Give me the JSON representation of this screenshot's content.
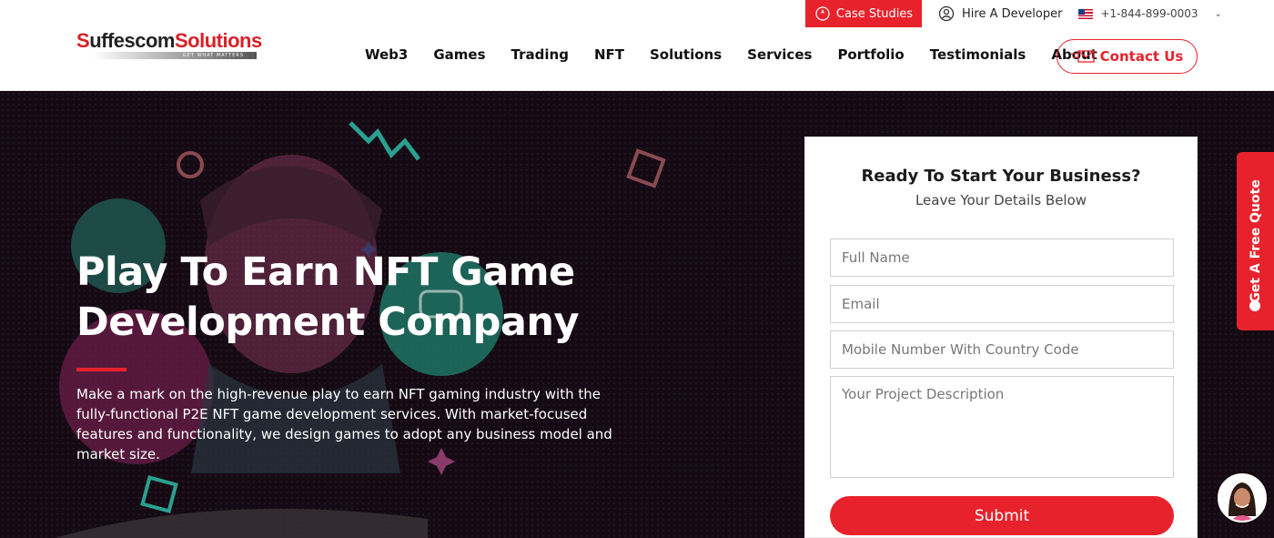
{
  "header": {
    "logo": {
      "first_letter": "S",
      "rest": "uffescom",
      "solutions": "Solutions",
      "tagline": "GET WHAT MATTERS"
    },
    "topbar": {
      "case_studies": "Case Studies",
      "hire_developer": "Hire A Developer",
      "phone": "+1-844-899-0003"
    },
    "nav": [
      "Web3",
      "Games",
      "Trading",
      "NFT",
      "Solutions",
      "Services",
      "Portfolio",
      "Testimonials",
      "About"
    ],
    "contact_label": "Contact Us"
  },
  "hero": {
    "title_line1": "Play To Earn NFT Game",
    "title_line2": "Development Company",
    "description": "Make a mark on the high-revenue play to earn NFT gaming industry with the fully-functional P2E NFT game development services. With market-focused features and functionality, we design games to adopt any business model and market size."
  },
  "form": {
    "title": "Ready To Start Your Business?",
    "subtitle": "Leave Your Details Below",
    "name_placeholder": "Full Name",
    "email_placeholder": "Email",
    "mobile_placeholder": "Mobile Number With Country Code",
    "description_placeholder": "Your Project Description",
    "submit_label": "Submit"
  },
  "side_tab": {
    "label": "Get A Free Quote"
  },
  "colors": {
    "brand_red": "#e8222c",
    "hero_bg": "#150a13",
    "teal": "#2a9d8f"
  }
}
